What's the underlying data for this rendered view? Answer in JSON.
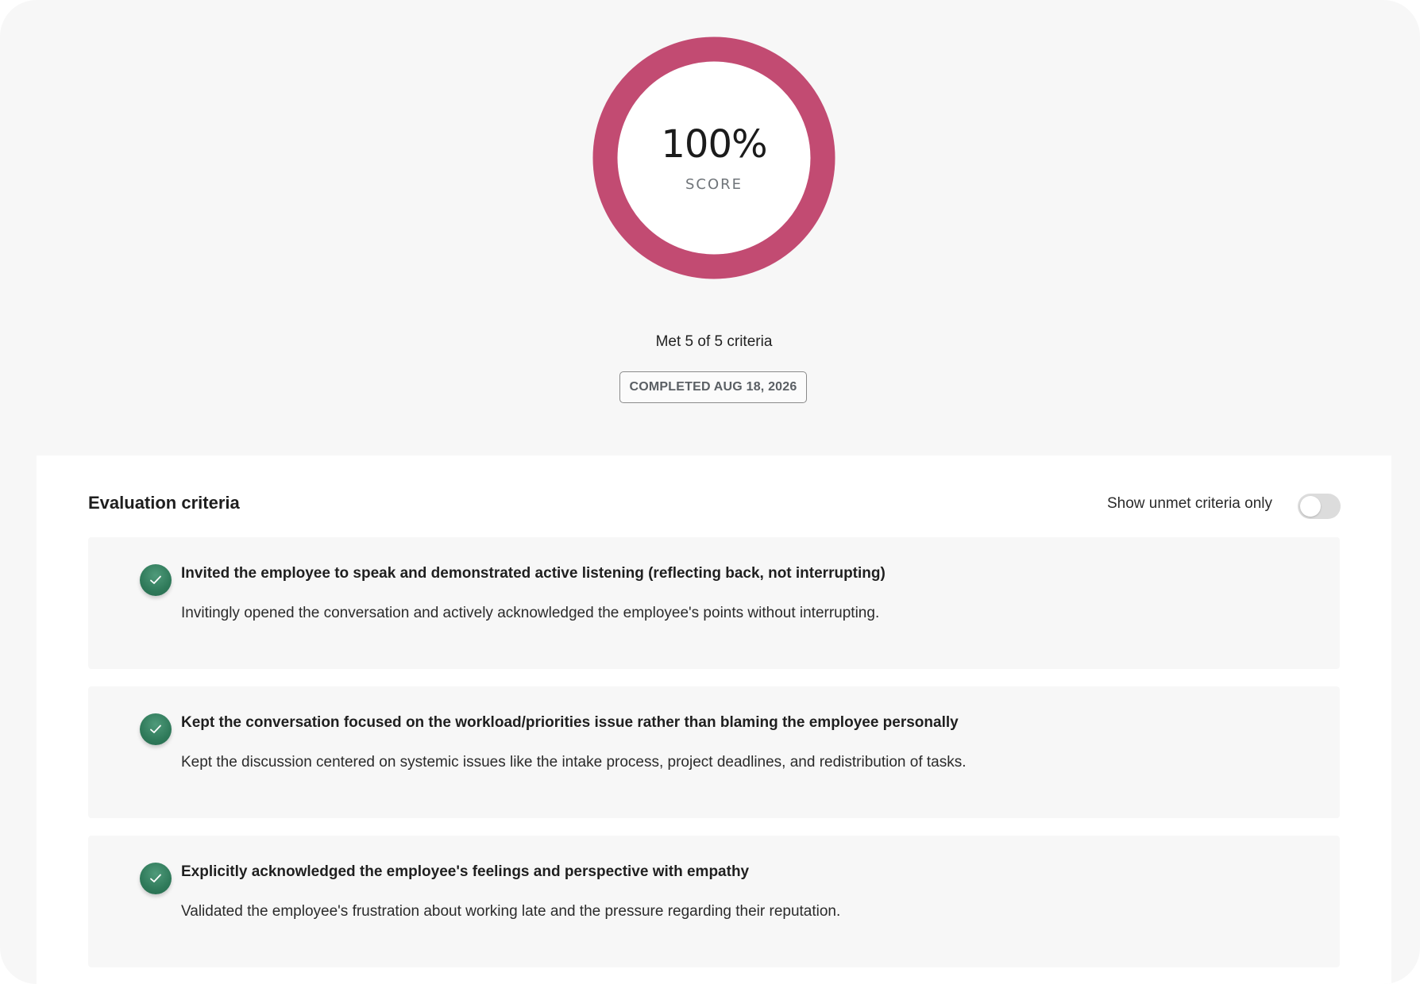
{
  "score": {
    "value": "100%",
    "label": "SCORE",
    "fraction": 1.0,
    "ring_color": "#c24b72",
    "ring_track_color": "#f1d2dc"
  },
  "summary": {
    "met_text": "Met 5 of 5 criteria",
    "completed_badge": "COMPLETED AUG 18, 2026"
  },
  "evaluation": {
    "title": "Evaluation criteria",
    "filter_toggle": {
      "label": "Show unmet criteria only",
      "on": false
    },
    "criteria": [
      {
        "status": "met",
        "status_icon": "check-icon",
        "title": "Invited the employee to speak and demonstrated active listening (reflecting back, not interrupting)",
        "description": "Invitingly opened the conversation and actively acknowledged the employee's points without interrupting."
      },
      {
        "status": "met",
        "status_icon": "check-icon",
        "title": "Kept the conversation focused on the workload/priorities issue rather than blaming the employee personally",
        "description": "Kept the discussion centered on systemic issues like the intake process, project deadlines, and redistribution of tasks."
      },
      {
        "status": "met",
        "status_icon": "check-icon",
        "title": "Explicitly acknowledged the employee's feelings and perspective with empathy",
        "description": "Validated the employee's frustration about working late and the pressure regarding their reputation."
      }
    ]
  },
  "colors": {
    "met_green": "#2f7a5a",
    "card_background": "#f7f7f7",
    "page_background": "#f7f7f7"
  }
}
